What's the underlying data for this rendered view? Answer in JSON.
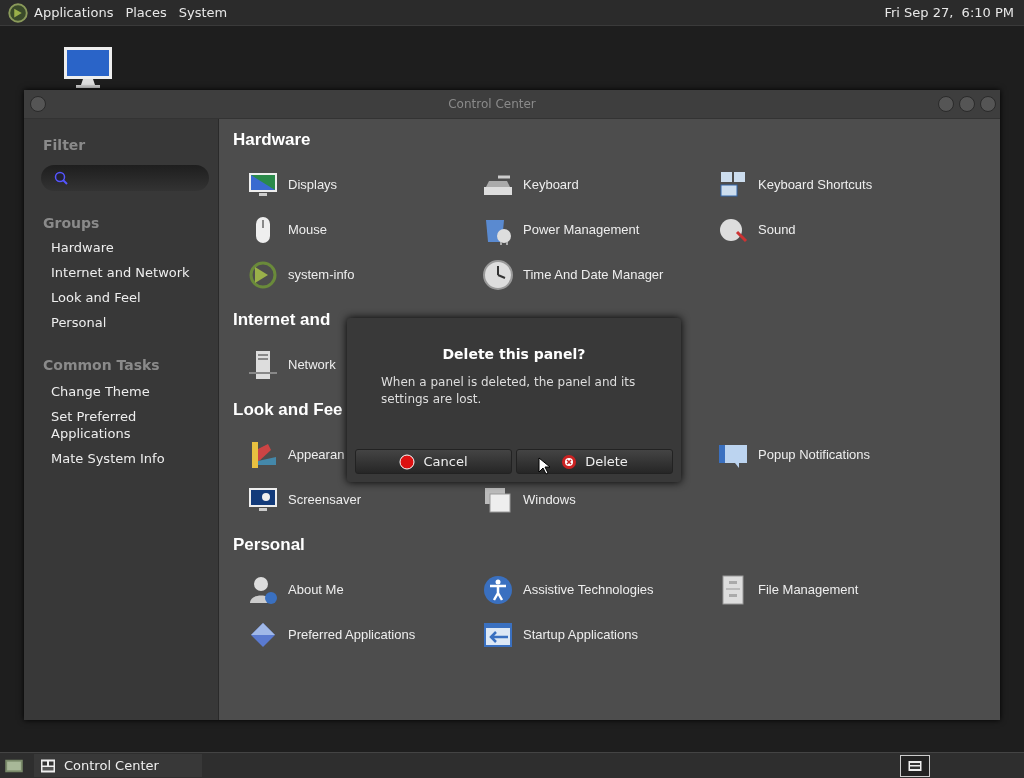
{
  "top_panel": {
    "menus": [
      "Applications",
      "Places",
      "System"
    ],
    "clock": "Fri Sep 27,  6:10 PM"
  },
  "window": {
    "title": "Control Center"
  },
  "sidebar": {
    "filter_heading": "Filter",
    "groups_heading": "Groups",
    "groups": [
      "Hardware",
      "Internet and Network",
      "Look and Feel",
      "Personal"
    ],
    "tasks_heading": "Common Tasks",
    "tasks": [
      "Change Theme",
      "Set Preferred Applications",
      "Mate System Info"
    ]
  },
  "sections": [
    {
      "title": "Hardware",
      "items": [
        {
          "kind": "item",
          "label": "Displays"
        },
        {
          "kind": "item",
          "label": "Keyboard"
        },
        {
          "kind": "item",
          "label": "Keyboard Shortcuts"
        },
        {
          "kind": "item",
          "label": "Mouse"
        },
        {
          "kind": "item",
          "label": "Power Management"
        },
        {
          "kind": "item",
          "label": "Sound"
        },
        {
          "kind": "item",
          "label": "system-info"
        },
        {
          "kind": "item",
          "label": "Time And Date Manager"
        }
      ]
    },
    {
      "title": "Internet and",
      "items": [
        {
          "kind": "item",
          "label": "Network"
        }
      ]
    },
    {
      "title": "Look and Fee",
      "items": [
        {
          "kind": "item",
          "label": "Appearan"
        },
        {
          "kind": "covered"
        },
        {
          "kind": "item",
          "label": "Popup Notifications"
        },
        {
          "kind": "item",
          "label": "Screensaver"
        },
        {
          "kind": "item",
          "label": "Windows"
        }
      ]
    },
    {
      "title": "Personal",
      "items": [
        {
          "kind": "item",
          "label": "About Me"
        },
        {
          "kind": "item",
          "label": "Assistive Technologies"
        },
        {
          "kind": "item",
          "label": "File Management"
        },
        {
          "kind": "item",
          "label": "Preferred Applications"
        },
        {
          "kind": "item",
          "label": "Startup Applications"
        }
      ]
    }
  ],
  "dialog": {
    "title": "Delete this panel?",
    "message": "When a panel is deleted, the panel and its settings are lost.",
    "buttons": [
      {
        "label": "Cancel",
        "kind": "cancel"
      },
      {
        "label": "Delete",
        "kind": "delete"
      }
    ]
  },
  "taskbar": {
    "windows": [
      {
        "label": "Control Center"
      }
    ]
  }
}
